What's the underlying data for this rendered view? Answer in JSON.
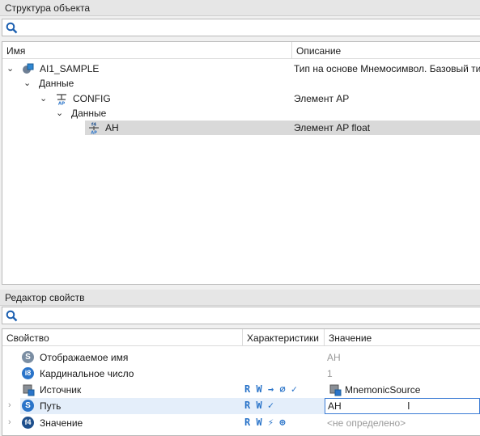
{
  "structure_panel": {
    "title": "Структура объекта",
    "columns": {
      "name": "Имя",
      "description": "Описание"
    },
    "tree": [
      {
        "label": "AI1_SAMPLE",
        "description": "Тип на основе Мнемосимвол. Базовый тип",
        "icon": "object-icon",
        "expanded": true
      },
      {
        "label": "Данные",
        "description": "",
        "icon": "",
        "expanded": true
      },
      {
        "label": "CONFIG",
        "description": "Элемент AP",
        "icon": "ap-element-icon",
        "expanded": true
      },
      {
        "label": "Данные",
        "description": "",
        "icon": "",
        "expanded": true
      },
      {
        "label": "AH",
        "description": "Элемент AP float",
        "icon": "f4-ap-icon",
        "selected": true
      }
    ]
  },
  "property_panel": {
    "title": "Редактор свойств",
    "columns": {
      "property": "Свойство",
      "characteristics": "Характеристики",
      "value": "Значение"
    },
    "rows": [
      {
        "name": "Отображаемое имя",
        "icon_text": "S",
        "characteristics": "",
        "value": "AH",
        "value_muted": true
      },
      {
        "name": "Кардинальное число",
        "icon_text": "i8",
        "characteristics": "",
        "value": "1",
        "value_muted": true
      },
      {
        "name": "Источник",
        "icon_text": "",
        "characteristics": "R W → ∅ ✓",
        "value": "MnemonicSource"
      },
      {
        "name": "Путь",
        "icon_text": "S",
        "characteristics": "R W ✓",
        "value": "AH",
        "editing": true
      },
      {
        "name": "Значение",
        "icon_text": "f4",
        "characteristics": "R W ⚡ ⊕",
        "value": "<не определено>",
        "value_muted": true
      }
    ]
  },
  "colors": {
    "accent": "#2a74c9",
    "selection": "#d9d9d9",
    "edit_border": "#3b7bd4"
  }
}
